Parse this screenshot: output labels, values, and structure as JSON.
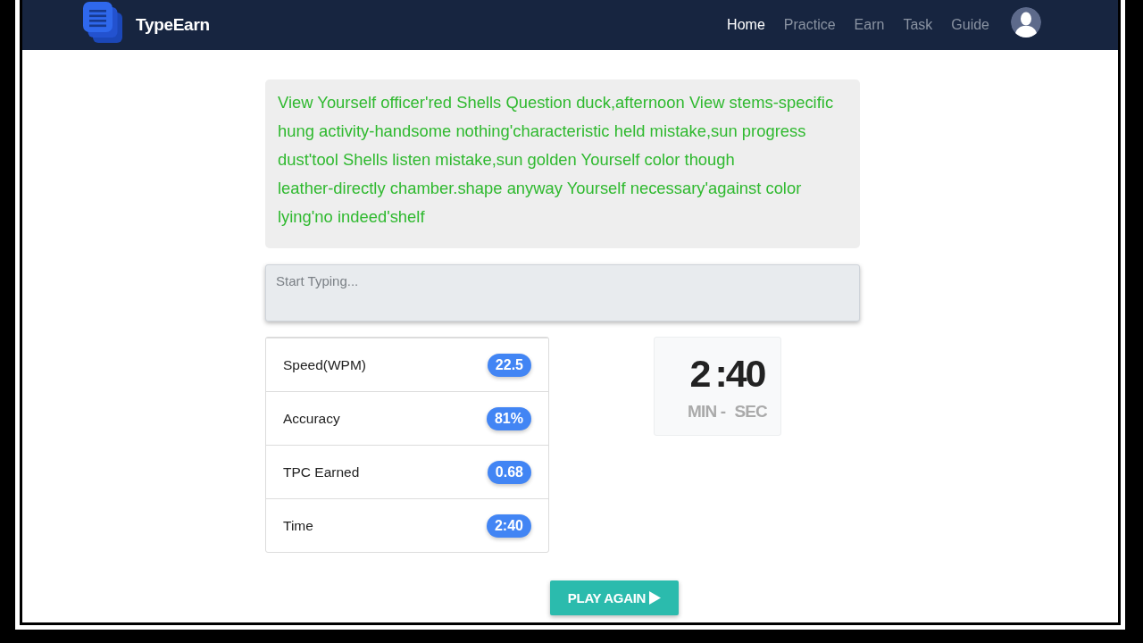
{
  "navbar": {
    "brand": "TypeEarn",
    "links": [
      {
        "label": "Home",
        "selected": true
      },
      {
        "label": "Practice",
        "selected": false
      },
      {
        "label": "Earn",
        "selected": false
      },
      {
        "label": "Task",
        "selected": false
      },
      {
        "label": "Guide",
        "selected": false
      }
    ]
  },
  "passage": {
    "text": "View Yourself officer'red Shells Question duck,afternoon View stems-specific hung activity-handsome nothing'characteristic held mistake,sun progress dust'tool Shells listen mistake,sun golden Yourself color though leather-directly chamber.shape anyway Yourself necessary'against color lying'no indeed'shelf"
  },
  "typing_field": {
    "placeholder": "Start Typing..."
  },
  "stats": [
    {
      "label": "Speed(WPM)",
      "value": "22.5"
    },
    {
      "label": "Accuracy",
      "value": "81%"
    },
    {
      "label": "TPC Earned",
      "value": "0.68"
    },
    {
      "label": "Time",
      "value": "2:40"
    }
  ],
  "timer": {
    "minutes": "2",
    "separator": ":",
    "seconds": "40",
    "unit_labels": [
      "MIN -",
      "SEC"
    ]
  },
  "play_button": {
    "label": "PLAY AGAIN"
  }
}
